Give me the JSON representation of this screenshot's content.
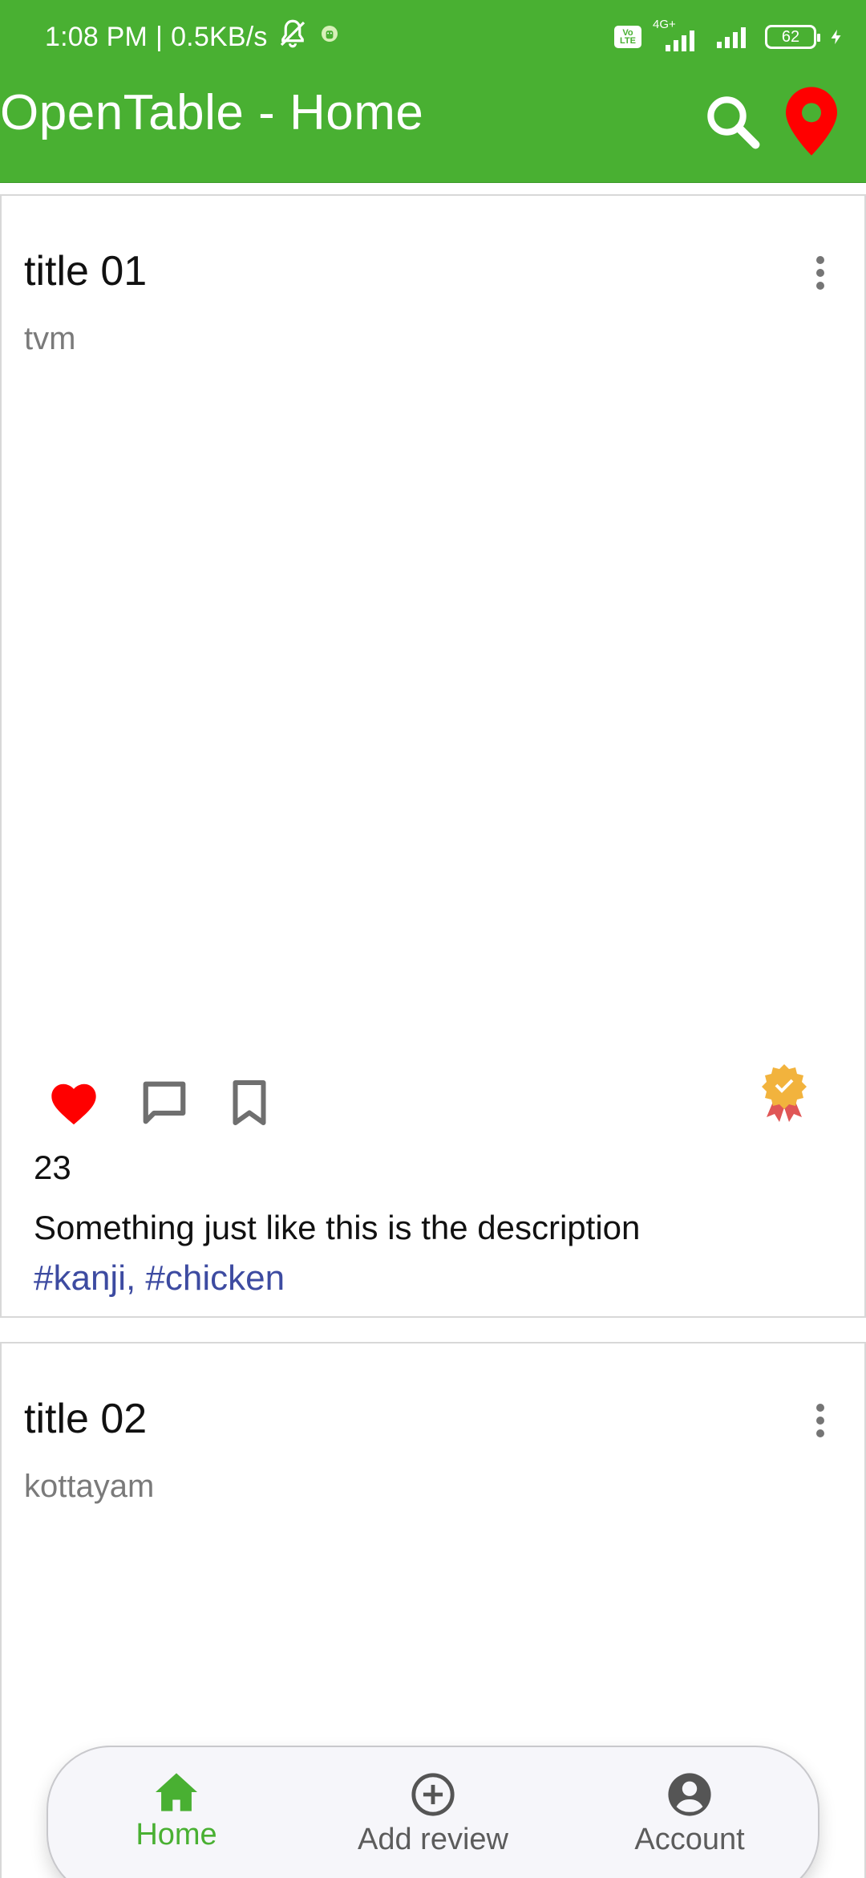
{
  "status_bar": {
    "time": "1:08 PM",
    "separator": "|",
    "speed": "0.5KB/s",
    "network": "4G+",
    "battery": "62",
    "icons": [
      "mute-bell-icon",
      "android-notification-icon",
      "volte-icon",
      "signal-icon",
      "signal-icon",
      "battery-icon",
      "charging-bolt-icon"
    ]
  },
  "app_bar": {
    "title": "OpenTable - Home",
    "icons": [
      "search-icon",
      "location-pin-icon"
    ],
    "location_icon_color": "#ff0000"
  },
  "posts": [
    {
      "title": "title 01",
      "location": "tvm",
      "likes": "23",
      "description": "Something just like this is the description",
      "tags": "#kanji, #chicken",
      "actions": [
        "heart-icon",
        "comment-icon",
        "bookmark-icon"
      ],
      "badge": "award-badge-icon",
      "liked": true
    },
    {
      "title": "title 02",
      "location": "kottayam"
    }
  ],
  "bottom_nav": {
    "items": [
      {
        "label": "Home",
        "icon": "home-icon",
        "active": true
      },
      {
        "label": "Add review",
        "icon": "add-circle-icon",
        "active": false
      },
      {
        "label": "Account",
        "icon": "account-circle-icon",
        "active": false
      }
    ]
  },
  "colors": {
    "primary": "#49b032",
    "tag": "#3d4ba1",
    "like": "#ff0000"
  }
}
